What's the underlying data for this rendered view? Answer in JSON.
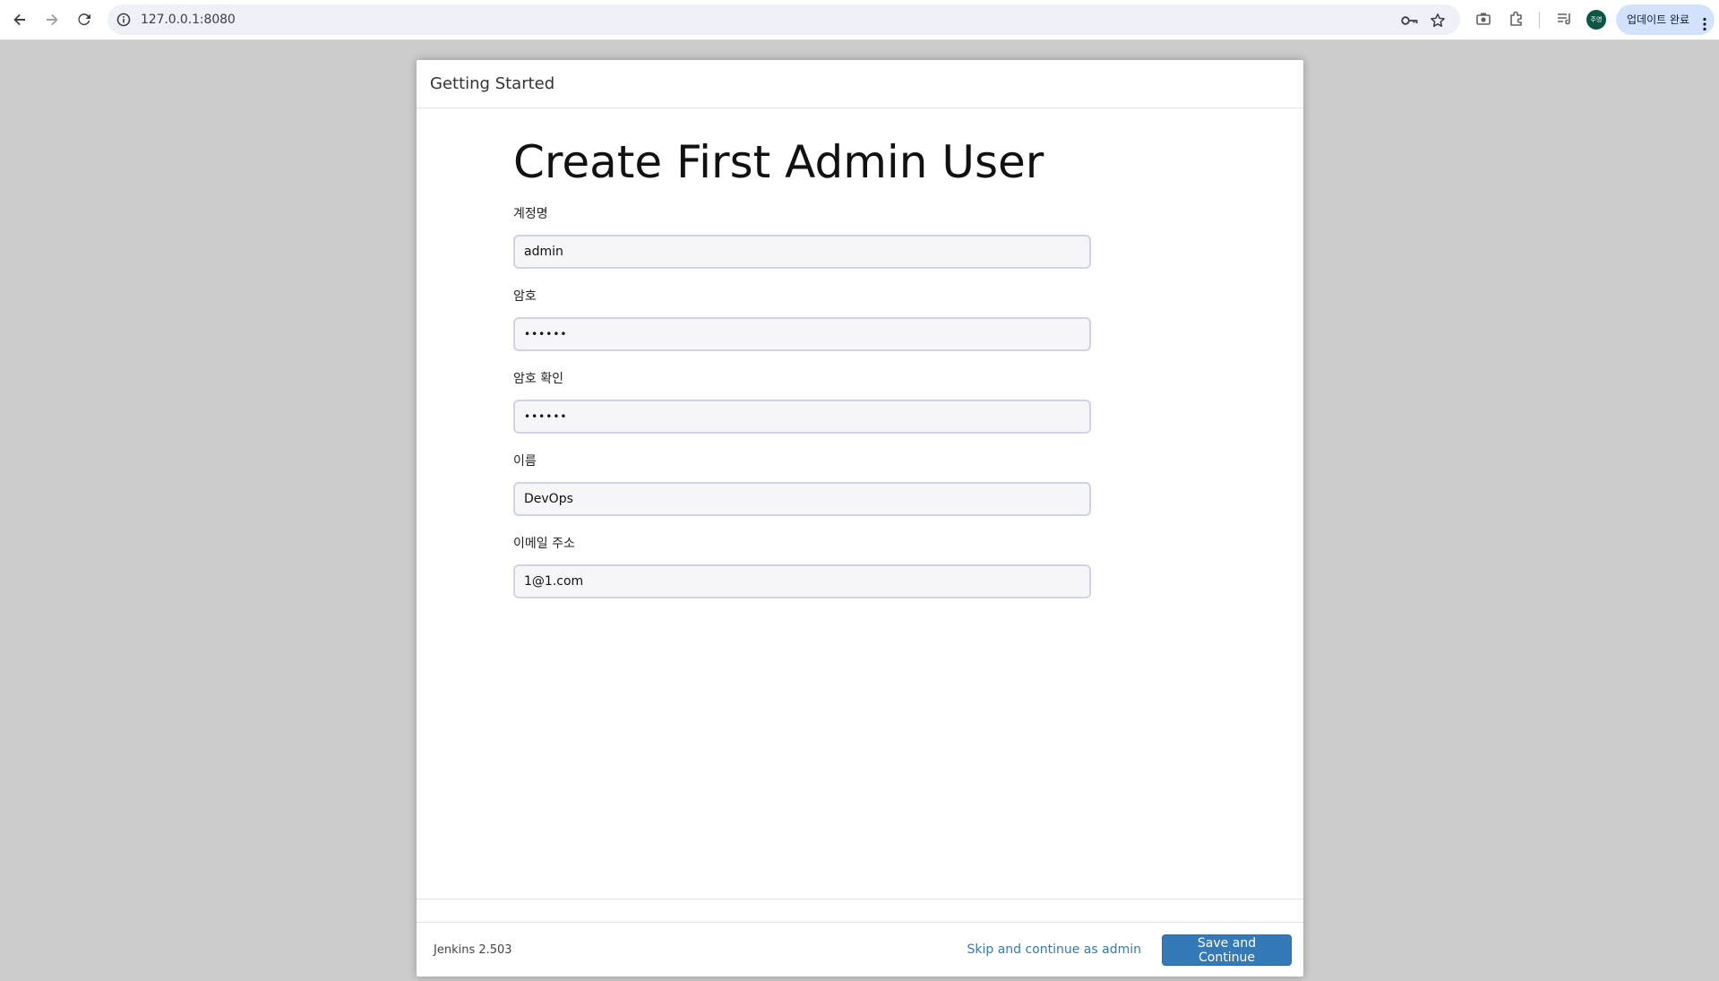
{
  "browser": {
    "url": "127.0.0.1:8080",
    "profile_initials": "주영",
    "update_label": "업데이트 완료"
  },
  "dialog": {
    "header_title": "Getting Started",
    "page_title": "Create First Admin User",
    "fields": {
      "username": {
        "label": "계정명",
        "value": "admin"
      },
      "password": {
        "label": "암호",
        "value": "••••••"
      },
      "password_confirm": {
        "label": "암호 확인",
        "value": "••••••"
      },
      "fullname": {
        "label": "이름",
        "value": "DevOps"
      },
      "email": {
        "label": "이메일 주소",
        "value": "1@1.com"
      }
    },
    "footer": {
      "version": "Jenkins 2.503",
      "skip_label": "Skip and continue as admin",
      "save_label": "Save and Continue"
    }
  },
  "colors": {
    "primary": "#337ab7",
    "backdrop": "#cccccc",
    "update_pill": "#d3e3fd",
    "avatar": "#0b5746"
  },
  "icons": [
    "back-icon",
    "forward-icon",
    "reload-icon",
    "site-info-icon",
    "password-key-icon",
    "bookmark-star-icon",
    "screenshot-icon",
    "extensions-icon",
    "reading-list-icon",
    "more-vert-icon"
  ]
}
